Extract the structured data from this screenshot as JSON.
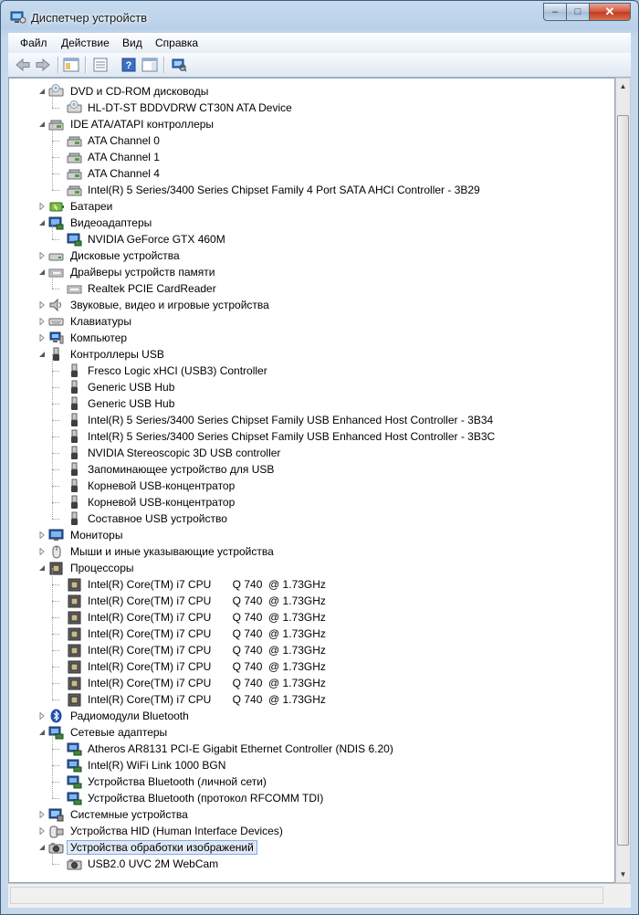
{
  "window": {
    "title": "Диспетчер устройств",
    "minimize_symbol": "–",
    "maximize_symbol": "□",
    "close_symbol": "✕"
  },
  "menu": [
    "Файл",
    "Действие",
    "Вид",
    "Справка"
  ],
  "toolbar": [
    "back-icon",
    "forward-icon",
    "show-hide-tree-icon",
    "properties-icon",
    "help-icon",
    "action-pane-icon",
    "scan-hardware-icon"
  ],
  "tree": [
    {
      "depth": 0,
      "expanded": true,
      "label": "DVD и CD-ROM дисководы",
      "icon": "dvd-drive-icon"
    },
    {
      "depth": 1,
      "label": "HL-DT-ST BDDVDRW CT30N ATA Device",
      "icon": "dvd-drive-icon"
    },
    {
      "depth": 0,
      "expanded": true,
      "label": "IDE ATA/ATAPI контроллеры",
      "icon": "ide-controller-icon"
    },
    {
      "depth": 1,
      "label": "ATA Channel 0",
      "icon": "ide-controller-icon"
    },
    {
      "depth": 1,
      "label": "ATA Channel 1",
      "icon": "ide-controller-icon"
    },
    {
      "depth": 1,
      "label": "ATA Channel 4",
      "icon": "ide-controller-icon"
    },
    {
      "depth": 1,
      "label": "Intel(R) 5 Series/3400 Series Chipset Family 4 Port SATA AHCI Controller - 3B29",
      "icon": "ide-controller-icon"
    },
    {
      "depth": 0,
      "expanded": false,
      "label": "Батареи",
      "icon": "battery-icon"
    },
    {
      "depth": 0,
      "expanded": true,
      "label": "Видеоадаптеры",
      "icon": "display-adapter-icon"
    },
    {
      "depth": 1,
      "label": "NVIDIA GeForce GTX 460M",
      "icon": "display-adapter-icon"
    },
    {
      "depth": 0,
      "expanded": false,
      "label": "Дисковые устройства",
      "icon": "disk-drive-icon"
    },
    {
      "depth": 0,
      "expanded": true,
      "label": "Драйверы устройств памяти",
      "icon": "memory-device-icon"
    },
    {
      "depth": 1,
      "label": "Realtek PCIE CardReader",
      "icon": "memory-device-icon"
    },
    {
      "depth": 0,
      "expanded": false,
      "label": "Звуковые, видео и игровые устройства",
      "icon": "sound-icon"
    },
    {
      "depth": 0,
      "expanded": false,
      "label": "Клавиатуры",
      "icon": "keyboard-icon"
    },
    {
      "depth": 0,
      "expanded": false,
      "label": "Компьютер",
      "icon": "computer-icon"
    },
    {
      "depth": 0,
      "expanded": true,
      "label": "Контроллеры USB",
      "icon": "usb-icon"
    },
    {
      "depth": 1,
      "label": "Fresco Logic xHCI (USB3) Controller",
      "icon": "usb-icon"
    },
    {
      "depth": 1,
      "label": "Generic USB Hub",
      "icon": "usb-icon"
    },
    {
      "depth": 1,
      "label": "Generic USB Hub",
      "icon": "usb-icon"
    },
    {
      "depth": 1,
      "label": "Intel(R) 5 Series/3400 Series Chipset Family USB Enhanced Host Controller - 3B34",
      "icon": "usb-icon"
    },
    {
      "depth": 1,
      "label": "Intel(R) 5 Series/3400 Series Chipset Family USB Enhanced Host Controller - 3B3C",
      "icon": "usb-icon"
    },
    {
      "depth": 1,
      "label": "NVIDIA Stereoscopic 3D USB controller",
      "icon": "usb-icon"
    },
    {
      "depth": 1,
      "label": "Запоминающее устройство для USB",
      "icon": "usb-icon"
    },
    {
      "depth": 1,
      "label": "Корневой USB-концентратор",
      "icon": "usb-icon"
    },
    {
      "depth": 1,
      "label": "Корневой USB-концентратор",
      "icon": "usb-icon"
    },
    {
      "depth": 1,
      "label": "Составное USB устройство",
      "icon": "usb-icon"
    },
    {
      "depth": 0,
      "expanded": false,
      "label": "Мониторы",
      "icon": "monitor-icon"
    },
    {
      "depth": 0,
      "expanded": false,
      "label": "Мыши и иные указывающие устройства",
      "icon": "mouse-icon"
    },
    {
      "depth": 0,
      "expanded": true,
      "label": "Процессоры",
      "icon": "processor-icon"
    },
    {
      "depth": 1,
      "label": "Intel(R) Core(TM) i7 CPU       Q 740  @ 1.73GHz",
      "icon": "processor-icon"
    },
    {
      "depth": 1,
      "label": "Intel(R) Core(TM) i7 CPU       Q 740  @ 1.73GHz",
      "icon": "processor-icon"
    },
    {
      "depth": 1,
      "label": "Intel(R) Core(TM) i7 CPU       Q 740  @ 1.73GHz",
      "icon": "processor-icon"
    },
    {
      "depth": 1,
      "label": "Intel(R) Core(TM) i7 CPU       Q 740  @ 1.73GHz",
      "icon": "processor-icon"
    },
    {
      "depth": 1,
      "label": "Intel(R) Core(TM) i7 CPU       Q 740  @ 1.73GHz",
      "icon": "processor-icon"
    },
    {
      "depth": 1,
      "label": "Intel(R) Core(TM) i7 CPU       Q 740  @ 1.73GHz",
      "icon": "processor-icon"
    },
    {
      "depth": 1,
      "label": "Intel(R) Core(TM) i7 CPU       Q 740  @ 1.73GHz",
      "icon": "processor-icon"
    },
    {
      "depth": 1,
      "label": "Intel(R) Core(TM) i7 CPU       Q 740  @ 1.73GHz",
      "icon": "processor-icon"
    },
    {
      "depth": 0,
      "expanded": false,
      "label": "Радиомодули Bluetooth",
      "icon": "bluetooth-icon"
    },
    {
      "depth": 0,
      "expanded": true,
      "label": "Сетевые адаптеры",
      "icon": "network-adapter-icon"
    },
    {
      "depth": 1,
      "label": "Atheros AR8131 PCI-E Gigabit Ethernet Controller (NDIS 6.20)",
      "icon": "network-adapter-icon"
    },
    {
      "depth": 1,
      "label": "Intel(R) WiFi Link 1000 BGN",
      "icon": "network-adapter-icon"
    },
    {
      "depth": 1,
      "label": "Устройства Bluetooth (личной сети)",
      "icon": "network-adapter-icon"
    },
    {
      "depth": 1,
      "label": "Устройства Bluetooth (протокол RFCOMM TDI)",
      "icon": "network-adapter-icon"
    },
    {
      "depth": 0,
      "expanded": false,
      "label": "Системные устройства",
      "icon": "system-device-icon"
    },
    {
      "depth": 0,
      "expanded": false,
      "label": "Устройства HID (Human Interface Devices)",
      "icon": "hid-icon"
    },
    {
      "depth": 0,
      "expanded": true,
      "selected": true,
      "label": "Устройства обработки изображений",
      "icon": "imaging-device-icon"
    },
    {
      "depth": 1,
      "label": "USB2.0 UVC 2M WebCam",
      "icon": "imaging-device-icon"
    }
  ],
  "colors": {
    "selection_bg": "#dfe9f6",
    "selection_border": "#84acdd",
    "title_bar": "#b8d0e8",
    "close_button": "#c13a1e"
  }
}
